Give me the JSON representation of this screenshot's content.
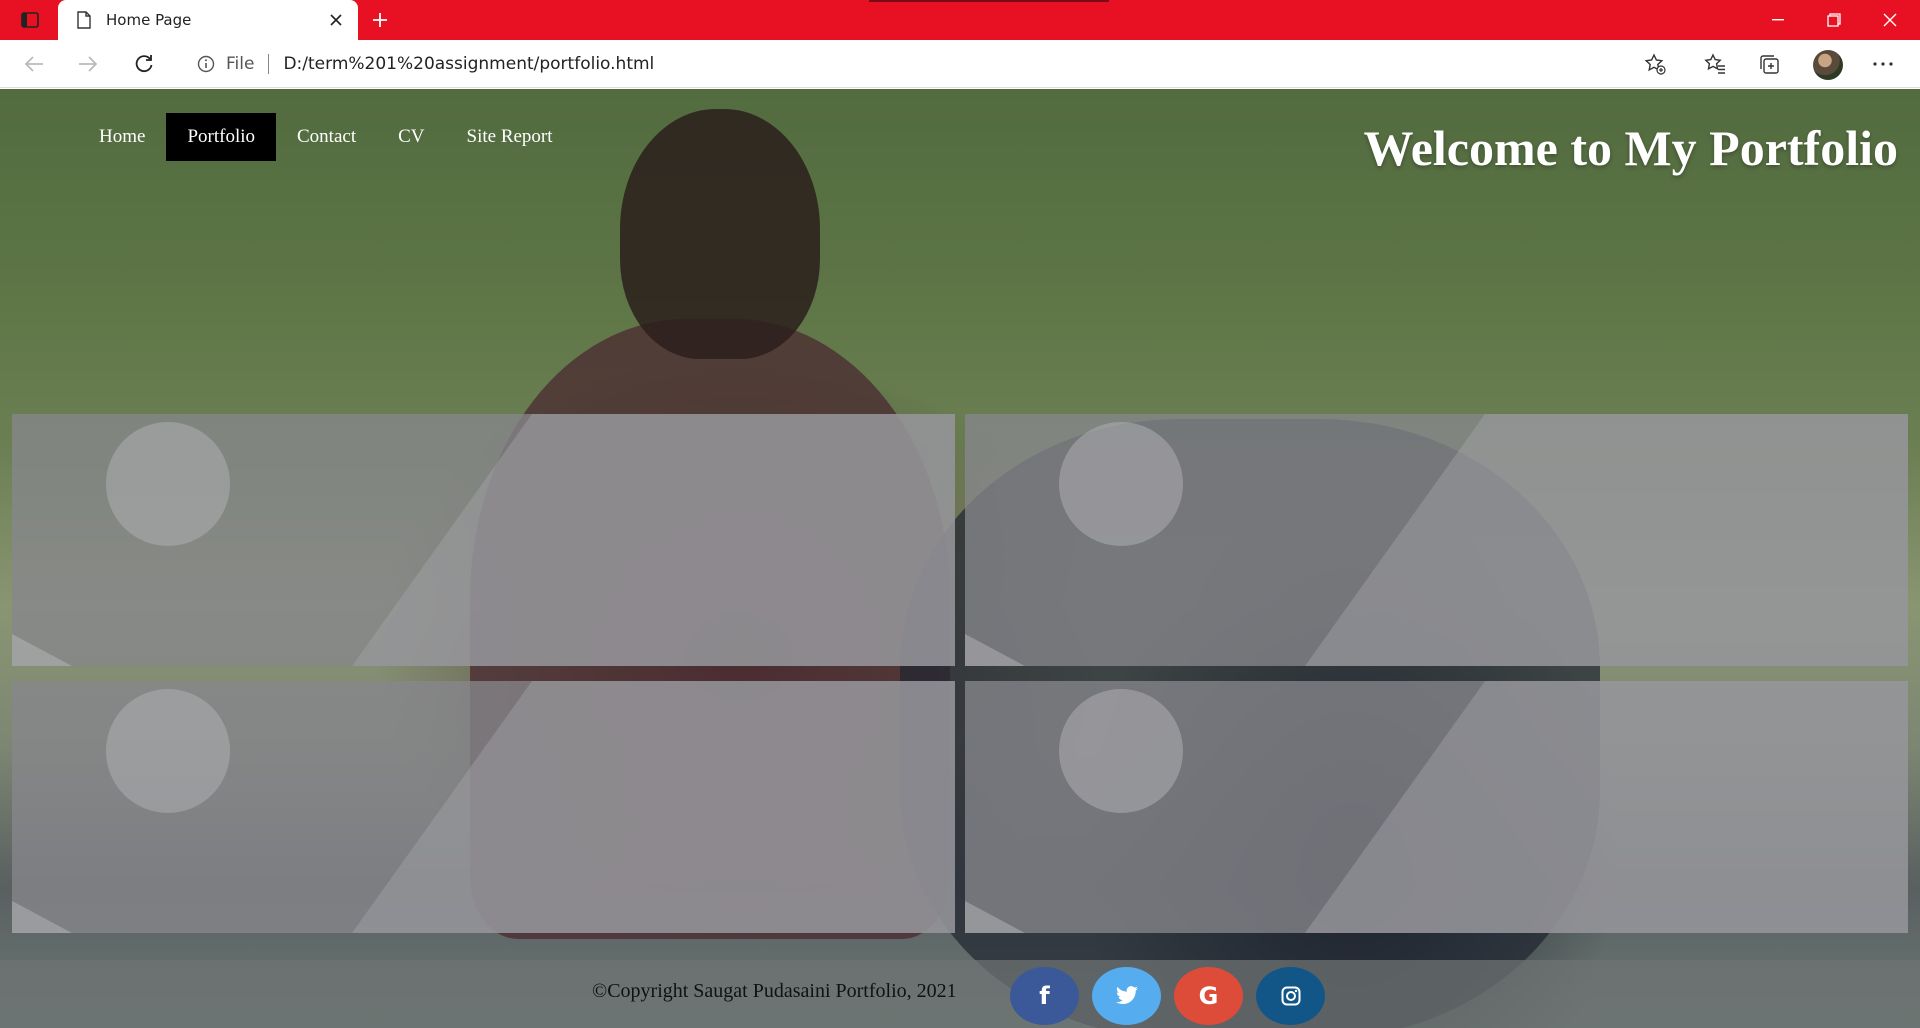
{
  "browser": {
    "tab_title": "Home Page",
    "scheme_label": "File",
    "url": "D:/term%201%20assignment/portfolio.html"
  },
  "nav": {
    "items": [
      {
        "label": "Home",
        "active": false
      },
      {
        "label": "Portfolio",
        "active": true
      },
      {
        "label": "Contact",
        "active": false
      },
      {
        "label": "CV",
        "active": false
      },
      {
        "label": "Site Report",
        "active": false
      }
    ]
  },
  "hero": {
    "title": "Welcome to My Portfolio"
  },
  "cards_count": 4,
  "footer": {
    "copyright": "©Copyright Saugat Pudasaini Portfolio, 2021",
    "social": [
      {
        "name": "facebook",
        "glyph": "f",
        "color": "#3b5998"
      },
      {
        "name": "twitter",
        "glyph": "twitter-icon",
        "color": "#55acee"
      },
      {
        "name": "google",
        "glyph": "G",
        "color": "#dd4b39"
      },
      {
        "name": "instagram",
        "glyph": "instagram-icon",
        "color": "#125688"
      }
    ]
  },
  "colors": {
    "tabbar": "#e81123",
    "nav_active_bg": "#000000",
    "card_overlay": "#87878c"
  }
}
